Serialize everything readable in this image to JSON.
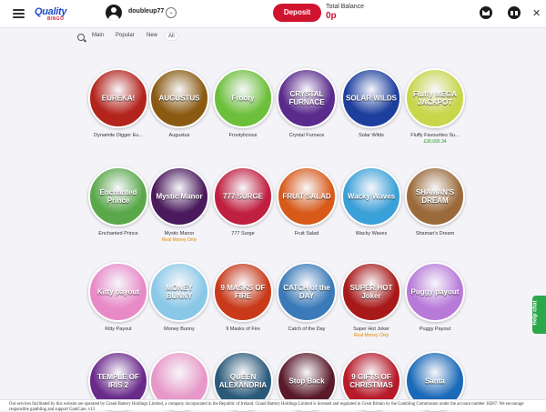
{
  "header": {
    "logo_line1": "Quality",
    "logo_line2": "BINGO",
    "username": "doubleup77",
    "deposit_label": "Deposit",
    "balance_label": "Total Balance",
    "balance_value": "0p"
  },
  "filters": [
    "Main",
    "Popular",
    "New",
    "All"
  ],
  "active_filter": "All",
  "games": [
    {
      "name": "Dynamite Digger Eu...",
      "logo": "EUREKA!",
      "bg": "#b3241c"
    },
    {
      "name": "Augustus",
      "logo": "AUGUSTUS",
      "bg": "#8a5a12"
    },
    {
      "name": "Frootylicious",
      "logo": "Frooty",
      "bg": "#6cbf3a"
    },
    {
      "name": "Crystal Furnace",
      "logo": "CRYSTAL FURNACE",
      "bg": "#5a2a8c"
    },
    {
      "name": "Solar Wilds",
      "logo": "SOLAR WILDS",
      "bg": "#1c3f9e"
    },
    {
      "name": "Fluffy Favourites Su...",
      "logo": "Fluffy MEGA JACKPOT",
      "bg": "#c8d64a",
      "sub": "£38,695.34",
      "sub_type": "jackpot"
    },
    {
      "name": "Enchanted Prince",
      "logo": "Enchanted Prince",
      "bg": "#5aa84a"
    },
    {
      "name": "Mystic Manor",
      "logo": "Mystic Manor",
      "bg": "#4a1a5c",
      "sub": "Real Money Only",
      "sub_type": "realmoney"
    },
    {
      "name": "777 Surge",
      "logo": "777 SURGE",
      "bg": "#c02040"
    },
    {
      "name": "Fruit Salad",
      "logo": "FRUIT SALAD",
      "bg": "#d85a1a"
    },
    {
      "name": "Wacky Waves",
      "logo": "Wacky Waves",
      "bg": "#3aa0d8"
    },
    {
      "name": "Shaman's Dream",
      "logo": "SHAMAN'S DREAM",
      "bg": "#9a6a3a"
    },
    {
      "name": "Kitty Payout",
      "logo": "Kitty payout",
      "bg": "#e88ac8"
    },
    {
      "name": "Money Bunny",
      "logo": "MONEY BUNNY",
      "bg": "#8ac8e8"
    },
    {
      "name": "9 Masks of Fire",
      "logo": "9 MASKS OF FIRE",
      "bg": "#c83a1a"
    },
    {
      "name": "Catch of the Day",
      "logo": "CATCH of the DAY",
      "bg": "#3a7ab8"
    },
    {
      "name": "Super Hot Joker",
      "logo": "SUPER HOT Joker",
      "bg": "#a81a1a",
      "sub": "Real Money Only",
      "sub_type": "realmoney"
    },
    {
      "name": "Puggy Payout",
      "logo": "Puggy payout",
      "bg": "#b87ad8"
    },
    {
      "name": "",
      "logo": "TEMPLE OF IRIS 2",
      "bg": "#6a2a8a"
    },
    {
      "name": "",
      "logo": "",
      "bg": "#e898c8"
    },
    {
      "name": "",
      "logo": "QUEEN ALEXANDRIA",
      "bg": "#2a5a7a"
    },
    {
      "name": "",
      "logo": "Stop Back",
      "bg": "#5a1a2a"
    },
    {
      "name": "",
      "logo": "9 GIFTS OF CHRISTMAS",
      "bg": "#b81a2a"
    },
    {
      "name": "",
      "logo": "Santa",
      "bg": "#1a6ab8"
    }
  ],
  "help_chat": "Help chat",
  "footer": {
    "text": "Our services facilitated by this website are operated by Grand Battery Holdings Limited, a company incorporated in the Republic of Ireland. Grand Battery Holdings Limited is licensed and regulated in Great Britain by the Gambling Commission under the account number 38287. We encourage responsible gambling and support GamCare. v13"
  },
  "colors": {
    "accent": "#d0132e",
    "jackpot": "#2a9c2a",
    "realmoney": "#e08a00",
    "helpchat": "#2aa84a"
  },
  "icons": [
    "hamburger-icon",
    "user-icon",
    "chevron-down-icon",
    "mail-icon",
    "gift-icon",
    "close-icon",
    "search-icon"
  ]
}
